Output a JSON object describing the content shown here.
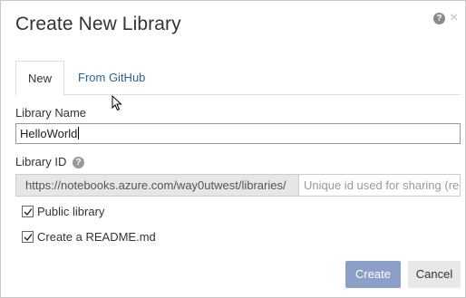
{
  "dialog": {
    "title": "Create New Library",
    "help_glyph": "?",
    "close_glyph": "×"
  },
  "tabs": [
    {
      "label": "New",
      "active": true
    },
    {
      "label": "From GitHub",
      "active": false
    }
  ],
  "form": {
    "library_name_label": "Library Name",
    "library_name_value": "HelloWorld",
    "library_id_label": "Library ID",
    "info_glyph": "?",
    "library_id_prefix": "https://notebooks.azure.com/way0utwest/libraries/",
    "library_id_placeholder": "Unique id used for sharing (required)"
  },
  "options": {
    "public_library_label": "Public library",
    "public_library_checked": true,
    "readme_label": "Create a README.md",
    "readme_checked": true
  },
  "buttons": {
    "create_label": "Create",
    "cancel_label": "Cancel"
  },
  "colors": {
    "primary_button": "#8b9fc9",
    "link": "#2a6496"
  }
}
